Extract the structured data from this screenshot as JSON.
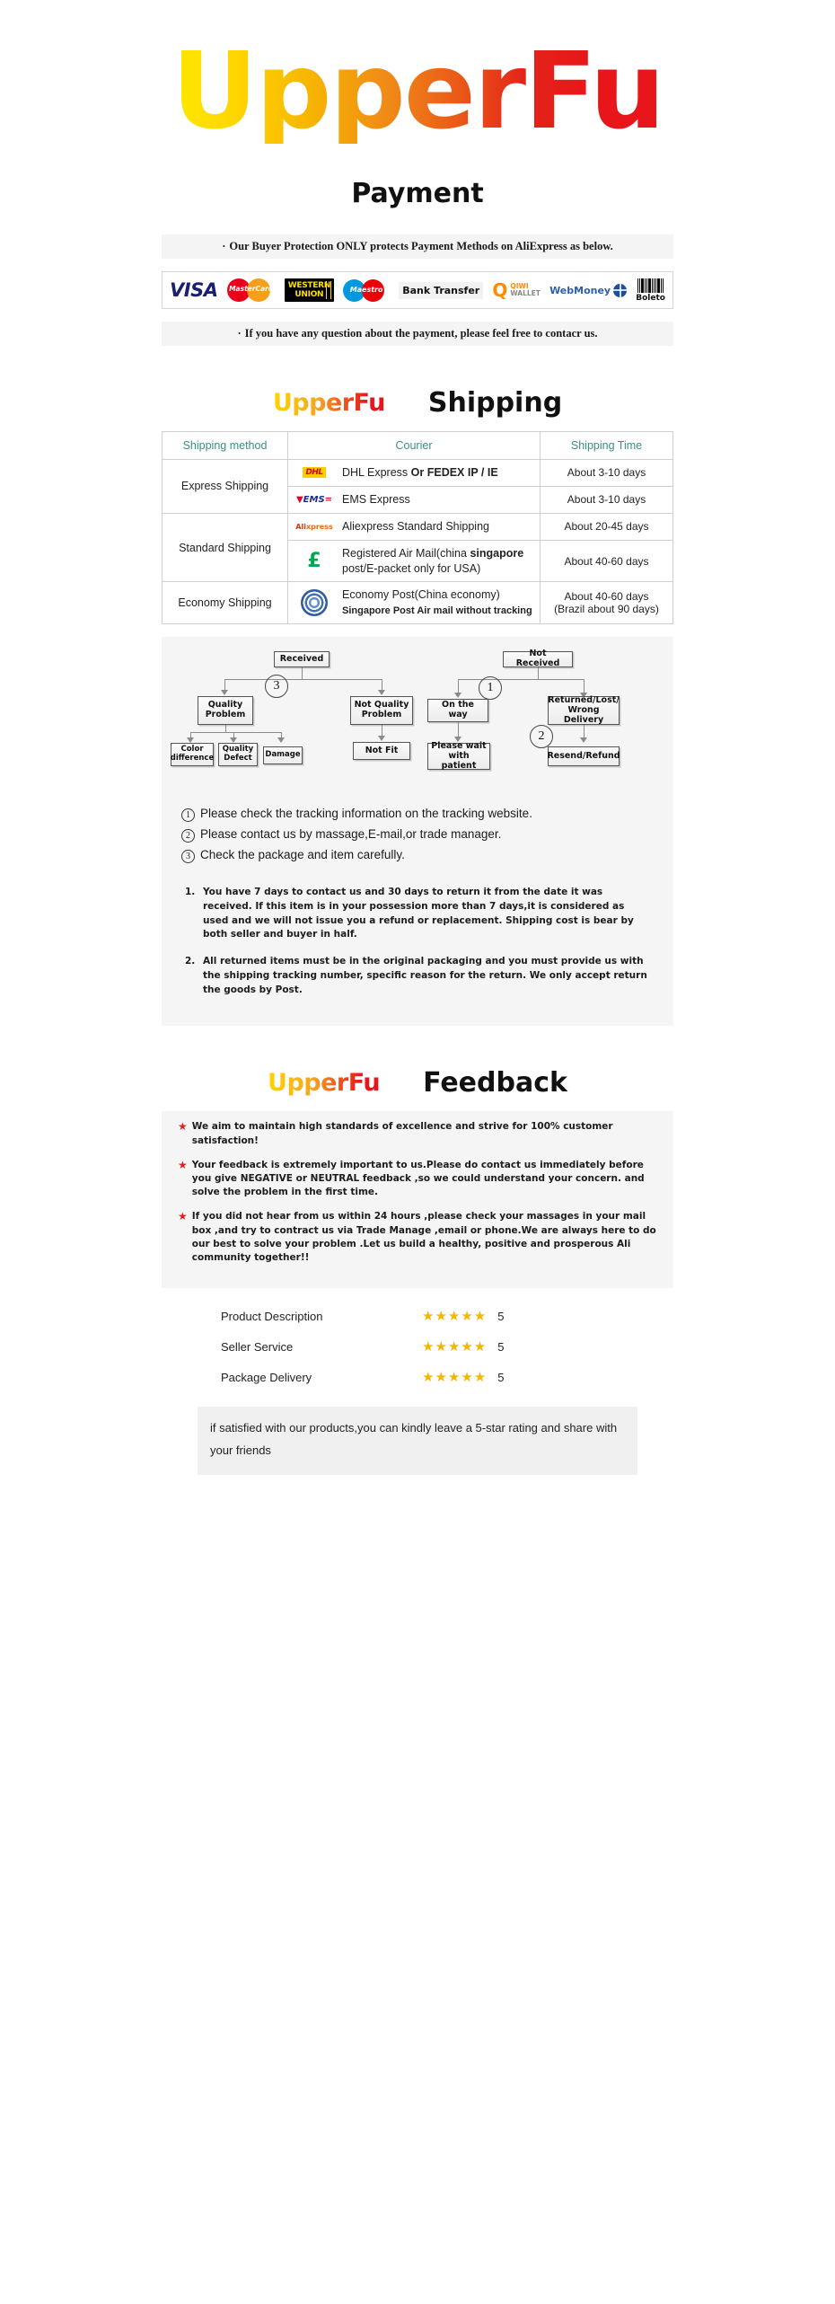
{
  "brand": {
    "name": "UpperFu"
  },
  "sections": {
    "payment": {
      "title": "Payment",
      "notice_top": "Our Buyer Protection ONLY protects Payment Methods on AliExpress as below.",
      "notice_bottom": "If you have any question about the payment, please feel free to contacr us.",
      "methods": [
        {
          "name": "visa-logo",
          "label": "VISA"
        },
        {
          "name": "mastercard-logo",
          "label": "MasterCard"
        },
        {
          "name": "western-union-logo",
          "label_line1": "WESTERN",
          "label_line2": "UNION"
        },
        {
          "name": "maestro-logo",
          "label": "Maestro"
        },
        {
          "name": "bank-transfer-logo",
          "label": "Bank Transfer"
        },
        {
          "name": "qiwi-wallet-logo",
          "label_line1": "QIWI",
          "label_line2": "WALLET",
          "mark": "Q"
        },
        {
          "name": "webmoney-logo",
          "label": "WebMoney"
        },
        {
          "name": "boleto-logo",
          "label": "Boleto"
        }
      ]
    },
    "shipping": {
      "title": "Shipping",
      "table": {
        "headers": [
          "Shipping method",
          "Courier",
          "Shipping Time"
        ],
        "rows": [
          {
            "method": "Express Shipping",
            "method_rowspan": 2,
            "logo": "dhl-logo",
            "courier": "DHL Express",
            "courier_bold": "Or FEDEX IP / IE",
            "time": "About 3-10 days"
          },
          {
            "logo": "ems-logo",
            "courier": "EMS Express",
            "time": "About 3-10 days"
          },
          {
            "method": "Standard Shipping",
            "method_rowspan": 2,
            "logo": "aliexpress-logo",
            "courier": "Aliexpress Standard Shipping",
            "time": "About 20-45 days"
          },
          {
            "logo": "china-post-logo",
            "courier": "Registered Air Mail(china",
            "courier_bold": "singapore",
            "courier_line2": "post/E-packet only for USA)",
            "time": "About 40-60 days"
          },
          {
            "method": "Economy Shipping",
            "method_rowspan": 1,
            "logo": "un-post-logo",
            "courier": "Economy Post(China economy)",
            "courier_bold2": "Singapore Post  Air mail without tracking",
            "time": "About 40-60 days",
            "time_line2": "(Brazil about 90 days)"
          }
        ]
      }
    },
    "flowchart": {
      "boxes": {
        "received": "Received",
        "not_received": "Not  Received",
        "quality_problem": "Quality\nProblem",
        "not_quality_problem": "Not Quality\nProblem",
        "color_difference": "Color\ndifference",
        "quality_defect": "Quality\nDefect",
        "damage": "Damage",
        "not_fit": "Not Fit",
        "on_the_way": "On the way",
        "returned_lost": "Returned/Lost/\nWrong Delivery",
        "please_wait": "Please wait\nwith patient",
        "resend_refund": "Resend/Refund"
      },
      "markers": {
        "one": "1",
        "two": "2",
        "three": "3"
      }
    },
    "notes": [
      {
        "num": "1",
        "text": "Please check the tracking information on the tracking website."
      },
      {
        "num": "2",
        "text": "Please contact us by  massage,E-mail,or trade manager."
      },
      {
        "num": "3",
        "text": "Check the package and item carefully."
      }
    ],
    "policy": [
      {
        "num": "1.",
        "text": "You have 7 days to contact us and 30 days to return it from the date it was received. If this item is in your possession more than 7 days,it is considered as used and we will not issue you a refund or replacement. Shipping cost is bear by both seller and buyer in half."
      },
      {
        "num": "2.",
        "text": "All returned items must be in the original packaging and you must provide us with the shipping tracking number, specific reason for the return. We only accept return the goods by Post."
      }
    ],
    "feedback": {
      "title": "Feedback",
      "items": [
        "We aim to maintain high standards of excellence and strive  for 100% customer satisfaction!",
        "Your feedback is extremely important to us.Please do contact us immediately before you give NEGATIVE or NEUTRAL feedback ,so  we could understand your concern. and solve the problem in the first time.",
        "If you did not hear from us within 24 hours ,please check your massages in your mail box ,and try to contract us via Trade Manage ,email or phone.We are always here to do our best to solve your problem .Let us build a healthy, positive and prosperous Ali community together!!"
      ],
      "ratings": [
        {
          "label": "Product Description",
          "stars": "★★★★★",
          "score": "5"
        },
        {
          "label": "Seller Service",
          "stars": "★★★★★",
          "score": "5"
        },
        {
          "label": "Package Delivery",
          "stars": "★★★★★",
          "score": "5"
        }
      ],
      "closing": "if satisfied with our products,you can kindly leave a 5-star rating and share with your friends"
    }
  },
  "colors": {
    "brand_yellow": "#ffd400",
    "brand_red": "#e8151b",
    "table_header": "#3a8f80",
    "star": "#f6b600",
    "star_bullet": "#e02020"
  }
}
